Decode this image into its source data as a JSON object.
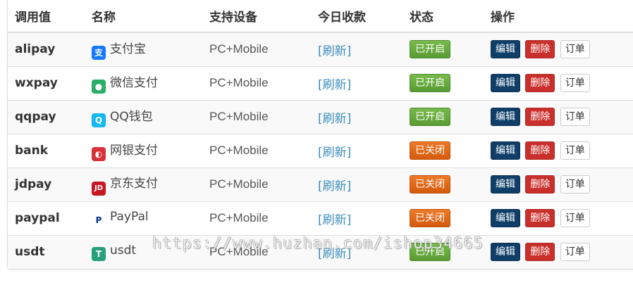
{
  "headers": [
    "调用值",
    "名称",
    "支持设备",
    "今日收款",
    "状态",
    "操作"
  ],
  "actions": {
    "edit": "编辑",
    "delete": "删除",
    "orders": "订单"
  },
  "rows": [
    {
      "code": "alipay",
      "name": "支付宝",
      "device": "PC+Mobile",
      "income": "[刷新]",
      "status": "已开启",
      "icon": "alipay-icon",
      "icon_glyph": "支",
      "icon_color": "#1677ff",
      "on": true
    },
    {
      "code": "wxpay",
      "name": "微信支付",
      "device": "PC+Mobile",
      "income": "[刷新]",
      "status": "已开启",
      "icon": "wechat-icon",
      "icon_glyph": "●",
      "icon_color": "#2aae67",
      "on": true
    },
    {
      "code": "qqpay",
      "name": "QQ钱包",
      "device": "PC+Mobile",
      "income": "[刷新]",
      "status": "已开启",
      "icon": "qq-icon",
      "icon_glyph": "Q",
      "icon_color": "#12b7f5",
      "on": true
    },
    {
      "code": "bank",
      "name": "网银支付",
      "device": "PC+Mobile",
      "income": "[刷新]",
      "status": "已关闭",
      "icon": "unionpay-icon",
      "icon_glyph": "◐",
      "icon_color": "#d8313a",
      "on": false
    },
    {
      "code": "jdpay",
      "name": "京东支付",
      "device": "PC+Mobile",
      "income": "[刷新]",
      "status": "已关闭",
      "icon": "jd-icon",
      "icon_glyph": "JD",
      "icon_color": "#c91623",
      "on": false
    },
    {
      "code": "paypal",
      "name": "PayPal",
      "device": "PC+Mobile",
      "income": "[刷新]",
      "status": "已关闭",
      "icon": "paypal-icon",
      "icon_glyph": "P",
      "icon_color": "#ffffff",
      "icon_text_color": "#003087",
      "on": false
    },
    {
      "code": "usdt",
      "name": "usdt",
      "device": "PC+Mobile",
      "income": "[刷新]",
      "status": "已开启",
      "icon": "usdt-icon",
      "icon_glyph": "T",
      "icon_color": "#26a17b",
      "on": true
    }
  ],
  "watermark": "https://www.huzhan.com/ishop34665"
}
